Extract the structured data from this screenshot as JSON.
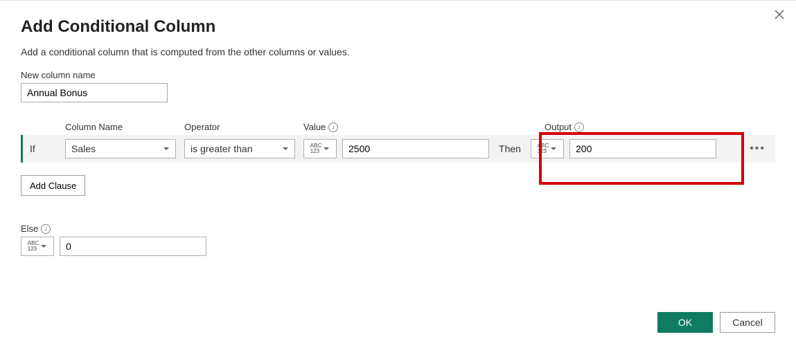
{
  "dialog": {
    "title": "Add Conditional Column",
    "subtitle": "Add a conditional column that is computed from the other columns or values."
  },
  "new_column": {
    "label": "New column name",
    "value": "Annual Bonus"
  },
  "headers": {
    "column_name": "Column Name",
    "operator": "Operator",
    "value": "Value",
    "output": "Output"
  },
  "clause": {
    "if_label": "If",
    "column_name": "Sales",
    "operator": "is greater than",
    "value_type_abc": "ABC",
    "value_type_123": "123",
    "value": "2500",
    "then_label": "Then",
    "output_type_abc": "ABC",
    "output_type_123": "123",
    "output": "200"
  },
  "add_clause": {
    "label": "Add Clause"
  },
  "else": {
    "label": "Else",
    "type_abc": "ABC",
    "type_123": "123",
    "value": "0"
  },
  "footer": {
    "ok": "OK",
    "cancel": "Cancel"
  }
}
